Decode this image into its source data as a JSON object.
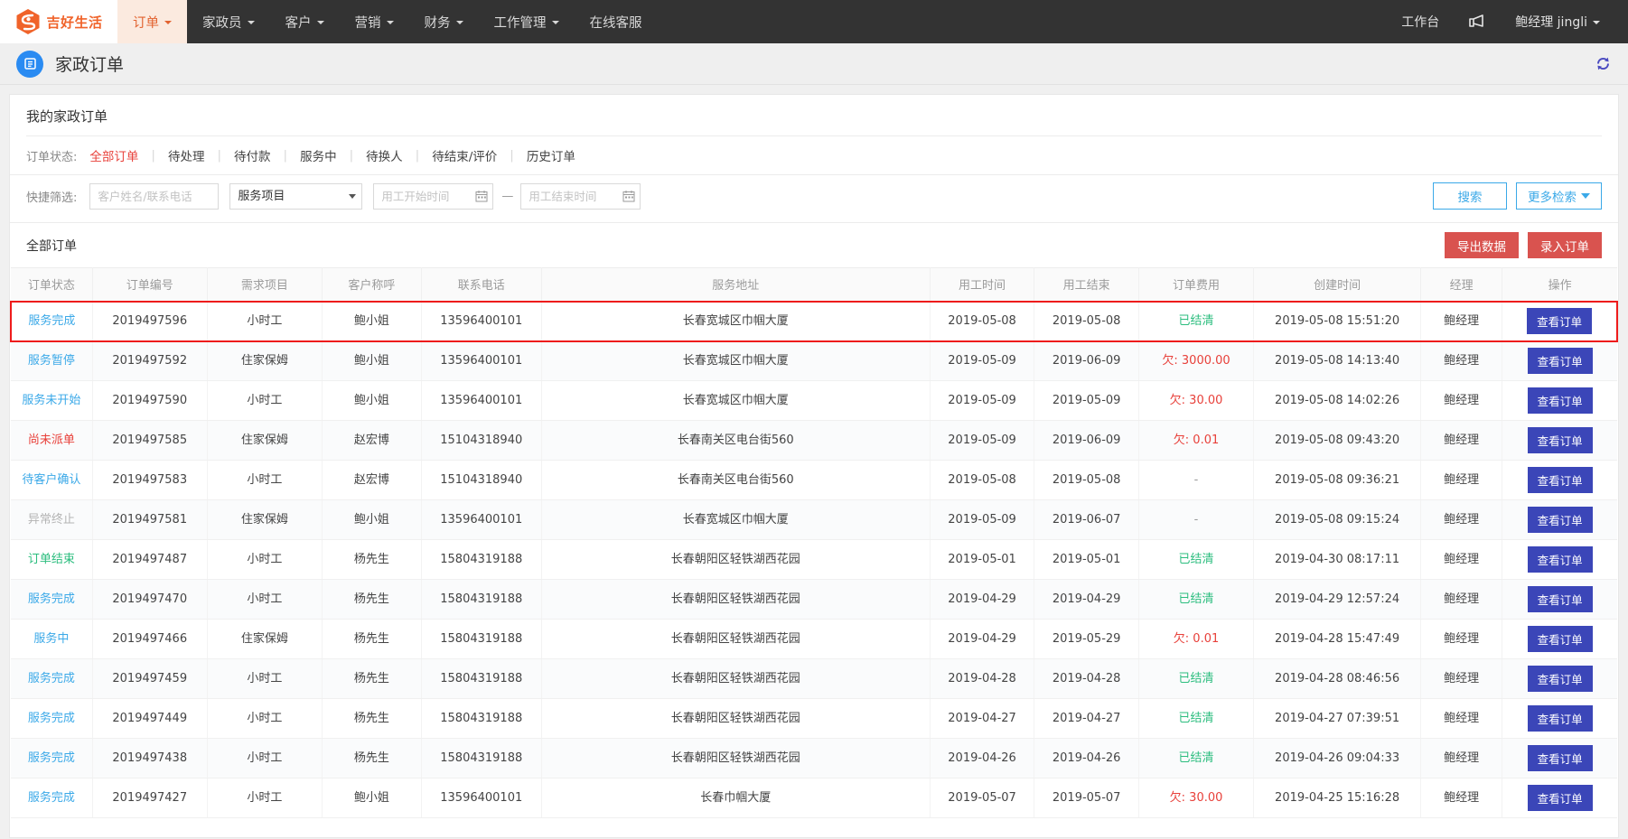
{
  "nav": {
    "brand": "吉好生活",
    "brand_color": "#f0632a",
    "items": [
      {
        "label": "订单",
        "has_caret": true,
        "active": true
      },
      {
        "label": "家政员",
        "has_caret": true,
        "active": false
      },
      {
        "label": "客户",
        "has_caret": true,
        "active": false
      },
      {
        "label": "营销",
        "has_caret": true,
        "active": false
      },
      {
        "label": "财务",
        "has_caret": true,
        "active": false
      },
      {
        "label": "工作管理",
        "has_caret": true,
        "active": false
      },
      {
        "label": "在线客服",
        "has_caret": false,
        "active": false
      }
    ],
    "workbench": "工作台",
    "user": "鲍经理 jingli"
  },
  "page": {
    "title": "家政订单"
  },
  "card": {
    "section_title": "我的家政订单",
    "status_filter_label": "订单状态:",
    "status_tabs": [
      {
        "label": "全部订单",
        "active": true
      },
      {
        "label": "待处理",
        "active": false
      },
      {
        "label": "待付款",
        "active": false
      },
      {
        "label": "服务中",
        "active": false
      },
      {
        "label": "待换人",
        "active": false
      },
      {
        "label": "待结束/评价",
        "active": false
      },
      {
        "label": "历史订单",
        "active": false
      }
    ],
    "quick_filter_label": "快捷筛选:",
    "name_placeholder": "客户姓名/联系电话",
    "name_value": "",
    "service_select": "服务项目",
    "date_start_placeholder": "用工开始时间",
    "date_start_value": "",
    "date_end_placeholder": "用工结束时间",
    "date_end_value": "",
    "date_separator": "—",
    "search_button": "搜索",
    "more_search_button": "更多检索"
  },
  "table": {
    "title": "全部订单",
    "export_button": "导出数据",
    "create_button": "录入订单",
    "view_button": "查看订单",
    "columns": [
      "订单状态",
      "订单编号",
      "需求项目",
      "客户称呼",
      "联系电话",
      "服务地址",
      "用工时间",
      "用工结束",
      "订单费用",
      "创建时间",
      "经理",
      "操作"
    ],
    "rows": [
      {
        "status": "服务完成",
        "status_color": "blue",
        "highlight": true,
        "order_no": "2019497596",
        "item": "小时工",
        "customer": "鲍小姐",
        "phone": "13596400101",
        "address": "长春宽城区巾帼大厦",
        "start": "2019-05-08",
        "end": "2019-05-08",
        "fee": "已结清",
        "fee_type": "paid",
        "created": "2019-05-08 15:51:20",
        "manager": "鲍经理"
      },
      {
        "status": "服务暂停",
        "status_color": "blue",
        "highlight": false,
        "order_no": "2019497592",
        "item": "住家保姆",
        "customer": "鲍小姐",
        "phone": "13596400101",
        "address": "长春宽城区巾帼大厦",
        "start": "2019-05-09",
        "end": "2019-06-09",
        "fee": "欠: 3000.00",
        "fee_type": "owe",
        "created": "2019-05-08 14:13:40",
        "manager": "鲍经理"
      },
      {
        "status": "服务未开始",
        "status_color": "blue",
        "highlight": false,
        "order_no": "2019497590",
        "item": "小时工",
        "customer": "鲍小姐",
        "phone": "13596400101",
        "address": "长春宽城区巾帼大厦",
        "start": "2019-05-09",
        "end": "2019-05-09",
        "fee": "欠: 30.00",
        "fee_type": "owe",
        "created": "2019-05-08 14:02:26",
        "manager": "鲍经理"
      },
      {
        "status": "尚未派单",
        "status_color": "red",
        "highlight": false,
        "order_no": "2019497585",
        "item": "住家保姆",
        "customer": "赵宏博",
        "phone": "15104318940",
        "address": "长春南关区电台街560",
        "start": "2019-05-09",
        "end": "2019-06-09",
        "fee": "欠: 0.01",
        "fee_type": "owe",
        "created": "2019-05-08 09:43:20",
        "manager": "鲍经理"
      },
      {
        "status": "待客户确认",
        "status_color": "blue",
        "highlight": false,
        "order_no": "2019497583",
        "item": "小时工",
        "customer": "赵宏博",
        "phone": "15104318940",
        "address": "长春南关区电台街560",
        "start": "2019-05-08",
        "end": "2019-05-08",
        "fee": "-",
        "fee_type": "none",
        "created": "2019-05-08 09:36:21",
        "manager": "鲍经理"
      },
      {
        "status": "异常终止",
        "status_color": "gray",
        "highlight": false,
        "order_no": "2019497581",
        "item": "住家保姆",
        "customer": "鲍小姐",
        "phone": "13596400101",
        "address": "长春宽城区巾帼大厦",
        "start": "2019-05-09",
        "end": "2019-06-07",
        "fee": "-",
        "fee_type": "none",
        "created": "2019-05-08 09:15:24",
        "manager": "鲍经理"
      },
      {
        "status": "订单结束",
        "status_color": "green",
        "highlight": false,
        "order_no": "2019497487",
        "item": "小时工",
        "customer": "杨先生",
        "phone": "15804319188",
        "address": "长春朝阳区轻铁湖西花园",
        "start": "2019-05-01",
        "end": "2019-05-01",
        "fee": "已结清",
        "fee_type": "paid",
        "created": "2019-04-30 08:17:11",
        "manager": "鲍经理"
      },
      {
        "status": "服务完成",
        "status_color": "blue",
        "highlight": false,
        "order_no": "2019497470",
        "item": "小时工",
        "customer": "杨先生",
        "phone": "15804319188",
        "address": "长春朝阳区轻铁湖西花园",
        "start": "2019-04-29",
        "end": "2019-04-29",
        "fee": "已结清",
        "fee_type": "paid",
        "created": "2019-04-29 12:57:24",
        "manager": "鲍经理"
      },
      {
        "status": "服务中",
        "status_color": "blue",
        "highlight": false,
        "order_no": "2019497466",
        "item": "住家保姆",
        "customer": "杨先生",
        "phone": "15804319188",
        "address": "长春朝阳区轻铁湖西花园",
        "start": "2019-04-29",
        "end": "2019-05-29",
        "fee": "欠: 0.01",
        "fee_type": "owe",
        "created": "2019-04-28 15:47:49",
        "manager": "鲍经理"
      },
      {
        "status": "服务完成",
        "status_color": "blue",
        "highlight": false,
        "order_no": "2019497459",
        "item": "小时工",
        "customer": "杨先生",
        "phone": "15804319188",
        "address": "长春朝阳区轻铁湖西花园",
        "start": "2019-04-28",
        "end": "2019-04-28",
        "fee": "已结清",
        "fee_type": "paid",
        "created": "2019-04-28 08:46:56",
        "manager": "鲍经理"
      },
      {
        "status": "服务完成",
        "status_color": "blue",
        "highlight": false,
        "order_no": "2019497449",
        "item": "小时工",
        "customer": "杨先生",
        "phone": "15804319188",
        "address": "长春朝阳区轻铁湖西花园",
        "start": "2019-04-27",
        "end": "2019-04-27",
        "fee": "已结清",
        "fee_type": "paid",
        "created": "2019-04-27 07:39:51",
        "manager": "鲍经理"
      },
      {
        "status": "服务完成",
        "status_color": "blue",
        "highlight": false,
        "order_no": "2019497438",
        "item": "小时工",
        "customer": "杨先生",
        "phone": "15804319188",
        "address": "长春朝阳区轻铁湖西花园",
        "start": "2019-04-26",
        "end": "2019-04-26",
        "fee": "已结清",
        "fee_type": "paid",
        "created": "2019-04-26 09:04:33",
        "manager": "鲍经理"
      },
      {
        "status": "服务完成",
        "status_color": "blue",
        "highlight": false,
        "order_no": "2019497427",
        "item": "小时工",
        "customer": "鲍小姐",
        "phone": "13596400101",
        "address": "长春巾帼大厦",
        "start": "2019-05-07",
        "end": "2019-05-07",
        "fee": "欠: 30.00",
        "fee_type": "owe",
        "created": "2019-04-25 15:16:28",
        "manager": "鲍经理"
      }
    ]
  }
}
